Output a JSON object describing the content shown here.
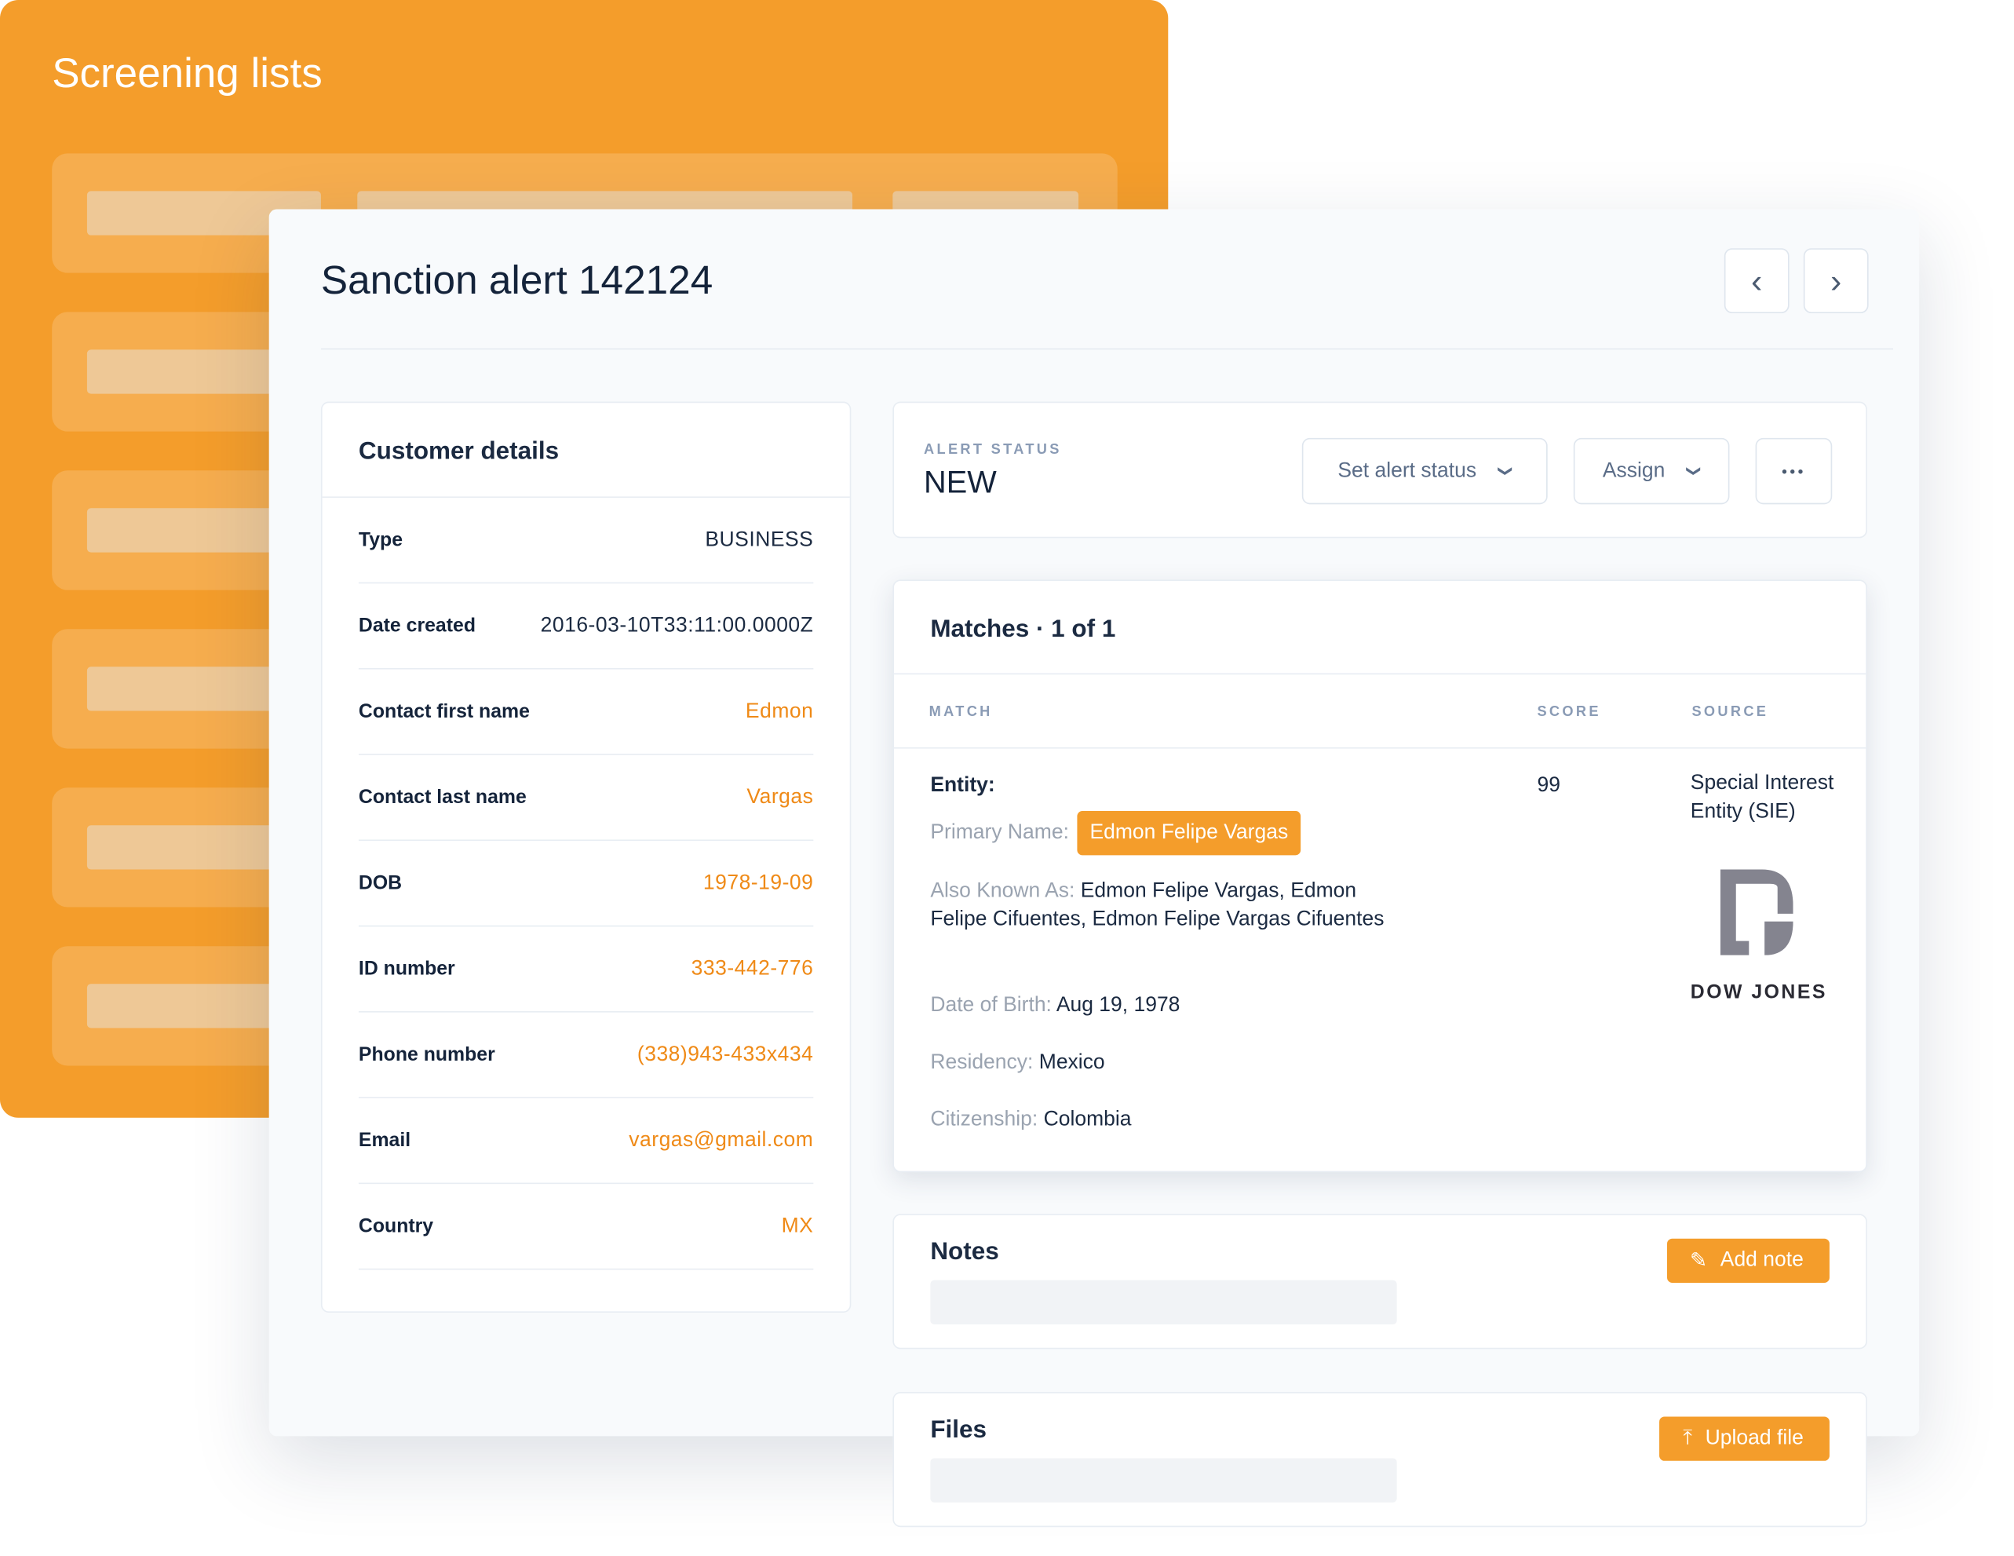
{
  "background": {
    "title": "Screening lists",
    "accent": "#F49D2B"
  },
  "alert": {
    "title": "Sanction alert 142124",
    "prev_icon": "chevron-left",
    "next_icon": "chevron-right"
  },
  "customer": {
    "heading": "Customer details",
    "rows": [
      {
        "label": "Type",
        "value": "BUSINESS"
      },
      {
        "label": "Date created",
        "value": "2016-03-10T33:11:00.0000Z"
      },
      {
        "label": "Contact first name",
        "value": "Edmon"
      },
      {
        "label": "Contact last name",
        "value": "Vargas"
      },
      {
        "label": "DOB",
        "value": "1978-19-09"
      },
      {
        "label": "ID number",
        "value": "333-442-776"
      },
      {
        "label": "Phone number",
        "value": "(338)943-433x434"
      },
      {
        "label": "Email",
        "value": "vargas@gmail.com"
      },
      {
        "label": "Country",
        "value": "MX"
      }
    ]
  },
  "status": {
    "label": "ALERT STATUS",
    "value": "NEW",
    "set_status": "Set alert status",
    "assign": "Assign",
    "more": "•••"
  },
  "matches": {
    "heading": "Matches · 1 of 1",
    "columns": [
      "MATCH",
      "SCORE",
      "SOURCE"
    ],
    "entity_label": "Entity:",
    "primary_name_label": "Primary Name:",
    "primary_name": "Edmon Felipe Vargas",
    "aka_label": "Also Known As:",
    "aka": "Edmon Felipe Vargas, Edmon Felipe Cifuentes, Edmon Felipe Vargas Cifuentes",
    "dob_label": "Date of Birth:",
    "dob": "Aug 19, 1978",
    "residency_label": "Residency:",
    "residency": "Mexico",
    "citizenship_label": "Citizenship:",
    "citizenship": "Colombia",
    "score": "99",
    "source": "Special Interest Entity (SIE)",
    "source_logo": "DOW JONES"
  },
  "notes": {
    "heading": "Notes",
    "button": "Add note"
  },
  "files": {
    "heading": "Files",
    "button": "Upload file"
  }
}
